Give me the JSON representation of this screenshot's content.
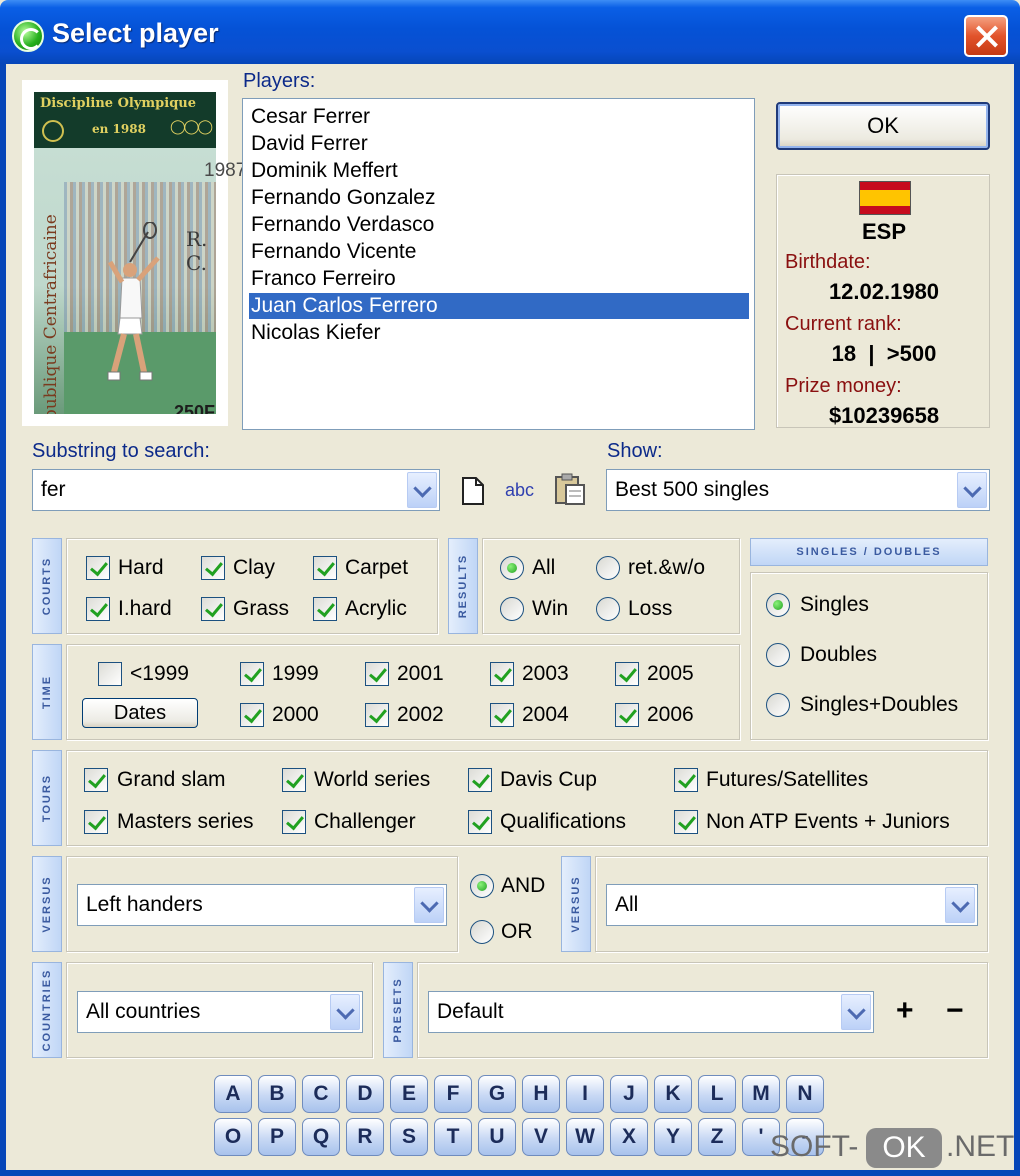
{
  "window": {
    "title": "Select player"
  },
  "stamp": {
    "line1": "Discipline Olympique",
    "line2": "en 1988",
    "country": "République Centrafricaine",
    "value": "250F",
    "postmark_year": "1987",
    "postmark_text": "R. C."
  },
  "players": {
    "label": "Players:",
    "items": [
      "Cesar Ferrer",
      "David Ferrer",
      "Dominik Meffert",
      "Fernando Gonzalez",
      "Fernando Verdasco",
      "Fernando Vicente",
      "Franco Ferreiro",
      "Juan Carlos Ferrero",
      "Nicolas Kiefer"
    ],
    "selected_index": 7
  },
  "ok_label": "OK",
  "info": {
    "country_code": "ESP",
    "birthdate_label": "Birthdate:",
    "birthdate": "12.02.1980",
    "rank_label": "Current rank:",
    "rank": "18  |  >500",
    "prize_label": "Prize money:",
    "prize": "$10239658"
  },
  "search": {
    "label": "Substring to search:",
    "value": "fer",
    "abc_label": "abc"
  },
  "show": {
    "label": "Show:",
    "value": "Best 500 singles"
  },
  "courts": {
    "tab": "COURTS",
    "items": [
      {
        "label": "Hard",
        "checked": true
      },
      {
        "label": "Clay",
        "checked": true
      },
      {
        "label": "Carpet",
        "checked": true
      },
      {
        "label": "I.hard",
        "checked": true
      },
      {
        "label": "Grass",
        "checked": true
      },
      {
        "label": "Acrylic",
        "checked": true
      }
    ]
  },
  "results": {
    "tab": "RESULTS",
    "items": [
      {
        "label": "All",
        "selected": true
      },
      {
        "label": "ret.&w/o",
        "selected": false
      },
      {
        "label": "Win",
        "selected": false
      },
      {
        "label": "Loss",
        "selected": false
      }
    ]
  },
  "singles_doubles": {
    "header": "SINGLES / DOUBLES",
    "items": [
      {
        "label": "Singles",
        "selected": true
      },
      {
        "label": "Doubles",
        "selected": false
      },
      {
        "label": "Singles+Doubles",
        "selected": false
      }
    ]
  },
  "time": {
    "tab": "TIME",
    "pre_label": "<1999",
    "pre_checked": false,
    "dates_label": "Dates",
    "years": [
      {
        "label": "1999",
        "checked": true
      },
      {
        "label": "2001",
        "checked": true
      },
      {
        "label": "2003",
        "checked": true
      },
      {
        "label": "2005",
        "checked": true
      },
      {
        "label": "2000",
        "checked": true
      },
      {
        "label": "2002",
        "checked": true
      },
      {
        "label": "2004",
        "checked": true
      },
      {
        "label": "2006",
        "checked": true
      }
    ]
  },
  "tours": {
    "tab": "TOURS",
    "items": [
      {
        "label": "Grand slam",
        "checked": true
      },
      {
        "label": "World series",
        "checked": true
      },
      {
        "label": "Davis Cup",
        "checked": true
      },
      {
        "label": "Futures/Satellites",
        "checked": true
      },
      {
        "label": "Masters series",
        "checked": true
      },
      {
        "label": "Challenger",
        "checked": true
      },
      {
        "label": "Qualifications",
        "checked": true
      },
      {
        "label": "Non ATP Events + Juniors",
        "checked": true
      }
    ]
  },
  "versus": {
    "tab": "VERSUS",
    "left_value": "Left handers",
    "right_value": "All",
    "and_label": "AND",
    "or_label": "OR",
    "and_selected": true
  },
  "countries": {
    "tab": "COUNTRIES",
    "value": "All countries"
  },
  "presets": {
    "tab": "PRESETS",
    "value": "Default",
    "add_label": "+",
    "remove_label": "−"
  },
  "letters": [
    "A",
    "B",
    "C",
    "D",
    "E",
    "F",
    "G",
    "H",
    "I",
    "J",
    "K",
    "L",
    "M",
    "N",
    "O",
    "P",
    "Q",
    "R",
    "S",
    "T",
    "U",
    "V",
    "W",
    "X",
    "Y",
    "Z",
    "'",
    "-"
  ],
  "watermark": {
    "left": "SOFT-",
    "mid": "OK",
    "right": ".NET"
  }
}
